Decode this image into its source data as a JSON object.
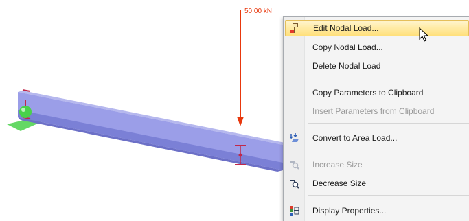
{
  "model_view": {
    "load_label": "50.00 kN",
    "colors": {
      "beam_top": "#9b9ee8",
      "beam_side": "#7b80d6",
      "support": "#49d14a",
      "load_arrow": "#e8380d",
      "member_mark": "#c0284a"
    }
  },
  "context_menu": {
    "items": [
      {
        "label": "Edit Nodal Load...",
        "icon": "edit-load-icon",
        "enabled": true,
        "highlighted": true
      },
      {
        "label": "Copy Nodal Load...",
        "icon": "",
        "enabled": true
      },
      {
        "label": "Delete Nodal Load",
        "icon": "",
        "enabled": true
      },
      {
        "label": "Copy Parameters to Clipboard",
        "icon": "",
        "enabled": true
      },
      {
        "label": "Insert Parameters from Clipboard",
        "icon": "",
        "enabled": false
      },
      {
        "label": "Convert to Area Load...",
        "icon": "convert-area-load-icon",
        "enabled": true
      },
      {
        "label": "Increase Size",
        "icon": "increase-size-icon",
        "enabled": false
      },
      {
        "label": "Decrease Size",
        "icon": "decrease-size-icon",
        "enabled": true
      },
      {
        "label": "Display Properties...",
        "icon": "display-properties-icon",
        "enabled": true
      }
    ]
  }
}
